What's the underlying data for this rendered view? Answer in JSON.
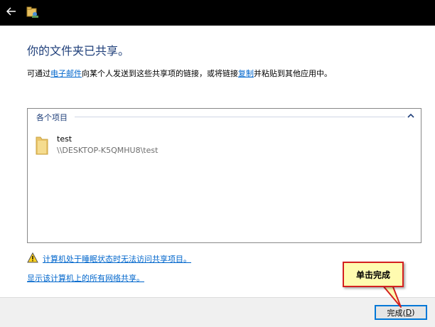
{
  "window": {
    "back_icon": "arrow-left-icon",
    "app_icon": "network-share-icon"
  },
  "header": {
    "title": "你的文件夹已共享。",
    "instruction_before": "可通过",
    "email_link": "电子邮件",
    "instruction_middle": "向某个人发送到这些共享项的链接，或将链接",
    "copy_link": "复制",
    "instruction_after": "并粘贴到其他应用中。"
  },
  "items_group": {
    "label": "各个项目",
    "collapse_icon": "chevron-up-icon",
    "items": [
      {
        "name": "test",
        "path": "\\\\DESKTOP-K5QMHU8\\test",
        "icon": "folder-icon"
      }
    ]
  },
  "warning": {
    "icon": "warning-icon",
    "text": "计算机处于睡眠状态时无法访问共享项目。"
  },
  "network_link": "显示该计算机上的所有网络共享。",
  "footer": {
    "finish_label": "完成(",
    "finish_mnemonic": "D",
    "finish_label_end": ")"
  },
  "annotation": {
    "text": "单击完成"
  },
  "colors": {
    "accent": "#0078d7",
    "heading": "#1f3f7a",
    "link": "#0066cc",
    "callout_fill": "#fffbb0",
    "callout_border": "#d42020"
  }
}
